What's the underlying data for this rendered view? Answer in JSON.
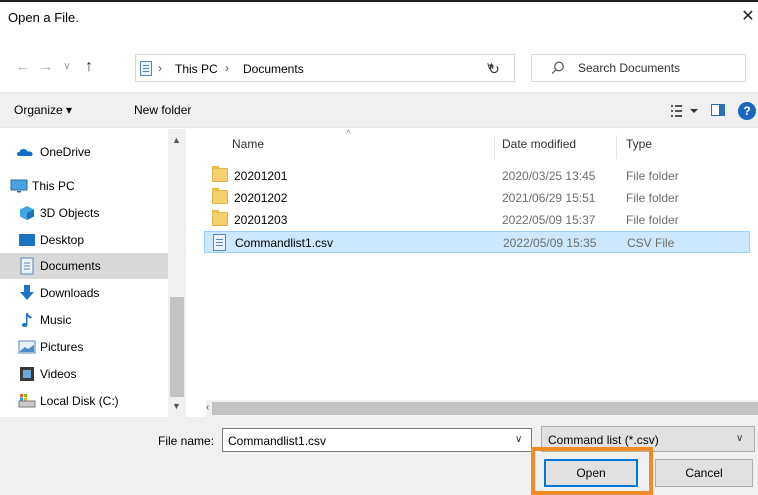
{
  "window": {
    "title": "Open a File.",
    "close_icon": "close-icon"
  },
  "address": {
    "breadcrumbs": [
      "This PC",
      "Documents"
    ],
    "search_placeholder": "Search Documents"
  },
  "toolbar": {
    "organize_label": "Organize ▾",
    "new_folder_label": "New folder",
    "help_label": "?"
  },
  "nav": {
    "items": [
      {
        "label": "OneDrive",
        "icon": "cloud-icon"
      },
      {
        "label": "This PC",
        "icon": "monitor-icon"
      },
      {
        "label": "3D Objects",
        "icon": "cube-icon"
      },
      {
        "label": "Desktop",
        "icon": "desktop-icon"
      },
      {
        "label": "Documents",
        "icon": "document-icon",
        "selected": true
      },
      {
        "label": "Downloads",
        "icon": "download-arrow-icon"
      },
      {
        "label": "Music",
        "icon": "music-note-icon"
      },
      {
        "label": "Pictures",
        "icon": "picture-icon"
      },
      {
        "label": "Videos",
        "icon": "film-icon"
      },
      {
        "label": "Local Disk (C:)",
        "icon": "drive-icon"
      }
    ]
  },
  "list": {
    "columns": {
      "name": "Name",
      "date": "Date modified",
      "type": "Type"
    },
    "rows": [
      {
        "name": "20201201",
        "date": "2020/03/25 13:45",
        "type": "File folder",
        "icon": "folder-icon"
      },
      {
        "name": "20201202",
        "date": "2021/06/29 15:51",
        "type": "File folder",
        "icon": "folder-icon"
      },
      {
        "name": "20201203",
        "date": "2022/05/09 15:37",
        "type": "File folder",
        "icon": "folder-icon"
      },
      {
        "name": "Commandlist1.csv",
        "date": "2022/05/09 15:35",
        "type": "CSV File",
        "icon": "csv-file-icon",
        "selected": true
      }
    ]
  },
  "bottom": {
    "file_name_label": "File name:",
    "file_name_value": "Commandlist1.csv",
    "filter_value": "Command list (*.csv)",
    "open_label": "Open",
    "cancel_label": "Cancel"
  },
  "colors": {
    "accent": "#0078d7",
    "highlight": "#f08b28",
    "selection": "#cce8ff"
  }
}
